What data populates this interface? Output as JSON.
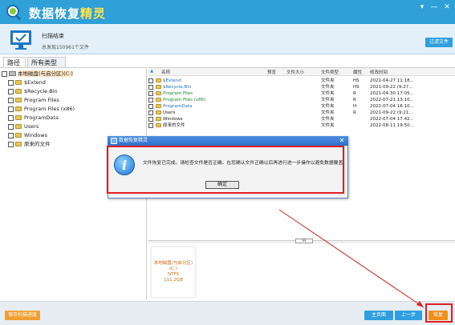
{
  "app": {
    "title_main": "数据恢复",
    "title_accent": "精灵"
  },
  "window_controls": {
    "dropdown": "▾",
    "minimize": "—",
    "close": "✕"
  },
  "scan": {
    "title": "扫描结束",
    "summary": "总发现150961个文件",
    "filter_label": "过滤文件"
  },
  "tabs": [
    {
      "label": "路径"
    },
    {
      "label": "所有类型"
    }
  ],
  "tree": {
    "root": "本地磁盘(与启分区)(C:)",
    "items": [
      {
        "label": "$Extend"
      },
      {
        "label": "$Recycle.Bin"
      },
      {
        "label": "Program Files"
      },
      {
        "label": "Program Files (x86)"
      },
      {
        "label": "ProgramData"
      },
      {
        "label": "Users"
      },
      {
        "label": "Windows"
      },
      {
        "label": "原来的文件"
      }
    ]
  },
  "list": {
    "columns": {
      "name": "名称",
      "status": "预览",
      "size": "文件大小",
      "type": "文件类型",
      "attr": "属性",
      "modified": "修改时间"
    },
    "rows": [
      {
        "name": "$Extend",
        "type": "文件夹",
        "attr": "HS",
        "modified": "2021-04-27 11:18..."
      },
      {
        "name": "$Recycle.Bin",
        "type": "文件夹",
        "attr": "HS",
        "modified": "2021-09-22 (9:27..."
      },
      {
        "name": "Program Files",
        "type": "文件夹",
        "attr": "R",
        "modified": "2021-04-30 17:05..."
      },
      {
        "name": "Program Files (x86)",
        "type": "文件夹",
        "attr": "R",
        "modified": "2022-07-21 13:10..."
      },
      {
        "name": "ProgramData",
        "type": "文件夹",
        "attr": "H",
        "modified": "2022-07-04 16:10..."
      },
      {
        "name": "Users",
        "type": "文件夹",
        "attr": "R",
        "modified": "2021-09-22 (9:21..."
      },
      {
        "name": "Windows",
        "type": "文件夹",
        "attr": "",
        "modified": "2022-07-04 17:42..."
      },
      {
        "name": "原来的文件",
        "type": "文件夹",
        "attr": "",
        "modified": "2022-08-11 19:50..."
      }
    ]
  },
  "drive_info": {
    "name": "本地磁盘(与启分区)(C:)",
    "fs": "NTFS",
    "size": "111.2GB"
  },
  "dialog": {
    "title": "数据恢复精灵",
    "message": "文件恢复已完成。请检查文件是否正确。在您确认文件正确以后再进行进一步操作以避免数据覆盖。",
    "ok_label": "确定"
  },
  "footer": {
    "save_label": "保存扫描进度",
    "home_label": "主页面",
    "prev_label": "上一步",
    "recover_label": "恢复"
  },
  "colors": {
    "titlebar": "#2fa0d8",
    "accent": "#ffe24a",
    "highlight_red": "#e02020",
    "button_blue": "#2f9fe0",
    "button_orange": "#f28e1c"
  }
}
